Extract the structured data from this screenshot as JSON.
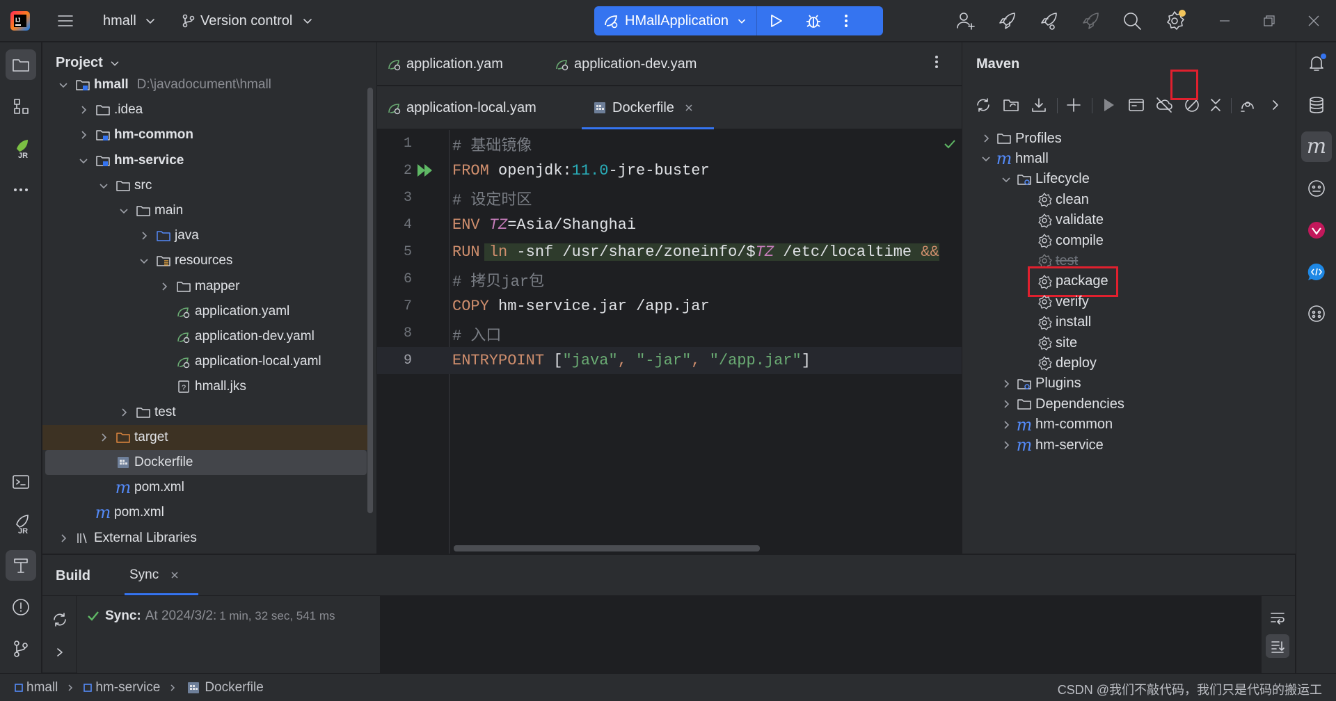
{
  "titlebar": {
    "project_name": "hmall",
    "vcs_label": "Version control",
    "run_config": "HMallApplication"
  },
  "project_panel": {
    "title": "Project",
    "tree": [
      {
        "label": "hmall",
        "path": "D:\\javadocument\\hmall",
        "bold": true,
        "icon": "module-folder-icon",
        "depth": 0,
        "chevron": "down"
      },
      {
        "label": ".idea",
        "icon": "folder-icon",
        "depth": 1,
        "chevron": "right"
      },
      {
        "label": "hm-common",
        "bold": true,
        "icon": "module-folder-icon",
        "depth": 1,
        "chevron": "right"
      },
      {
        "label": "hm-service",
        "bold": true,
        "icon": "module-folder-icon",
        "depth": 1,
        "chevron": "down"
      },
      {
        "label": "src",
        "icon": "folder-icon",
        "depth": 2,
        "chevron": "down"
      },
      {
        "label": "main",
        "icon": "folder-icon",
        "depth": 3,
        "chevron": "down"
      },
      {
        "label": "java",
        "icon": "source-folder-icon",
        "depth": 4,
        "chevron": "right"
      },
      {
        "label": "resources",
        "icon": "resources-folder-icon",
        "depth": 4,
        "chevron": "down"
      },
      {
        "label": "mapper",
        "icon": "folder-icon",
        "depth": 5,
        "chevron": "right"
      },
      {
        "label": "application.yaml",
        "icon": "spring-yaml-icon",
        "depth": 5
      },
      {
        "label": "application-dev.yaml",
        "icon": "spring-yaml-icon",
        "depth": 5
      },
      {
        "label": "application-local.yaml",
        "icon": "spring-yaml-icon",
        "depth": 5
      },
      {
        "label": "hmall.jks",
        "icon": "unknown-file-icon",
        "depth": 5
      },
      {
        "label": "test",
        "icon": "folder-icon",
        "depth": 3,
        "chevron": "right"
      },
      {
        "label": "target",
        "icon": "excluded-folder-icon",
        "depth": 2,
        "chevron": "right",
        "highlight": "target"
      },
      {
        "label": "Dockerfile",
        "icon": "docker-icon",
        "depth": 2,
        "highlight": "selected"
      },
      {
        "label": "pom.xml",
        "icon": "maven-icon",
        "depth": 2
      },
      {
        "label": "pom.xml",
        "icon": "maven-icon",
        "depth": 1
      },
      {
        "label": "External Libraries",
        "icon": "library-icon",
        "depth": 0,
        "chevron": "right"
      }
    ]
  },
  "editor": {
    "tabs_row1": [
      {
        "label": "application.yam"
      },
      {
        "label": "application-dev.yam"
      }
    ],
    "tabs_row2": [
      {
        "label": "application-local.yam"
      },
      {
        "label": "Dockerfile",
        "active": true
      }
    ],
    "lines": [
      {
        "n": "1",
        "tokens": [
          {
            "t": "# 基础镜像",
            "c": "cmt"
          }
        ]
      },
      {
        "n": "2",
        "tokens": [
          {
            "t": "FROM",
            "c": "kw"
          },
          {
            "t": " openjdk:",
            "c": ""
          },
          {
            "t": "11.0",
            "c": "num"
          },
          {
            "t": "-jre-buster",
            "c": ""
          }
        ]
      },
      {
        "n": "3",
        "tokens": [
          {
            "t": "# 设定时区",
            "c": "cmt"
          }
        ]
      },
      {
        "n": "4",
        "tokens": [
          {
            "t": "ENV",
            "c": "kw"
          },
          {
            "t": " ",
            "c": ""
          },
          {
            "t": "TZ",
            "c": "var"
          },
          {
            "t": "=Asia/Shanghai",
            "c": ""
          }
        ]
      },
      {
        "n": "5",
        "tokens": [
          {
            "t": "RUN",
            "c": "kw"
          },
          {
            "t": " ",
            "c": ""
          },
          {
            "t": "ln",
            "c": "kw"
          },
          {
            "t": " -snf /usr/share/zoneinfo/$",
            "c": ""
          },
          {
            "t": "TZ",
            "c": "var"
          },
          {
            "t": " /etc/localtime ",
            "c": ""
          },
          {
            "t": "&&",
            "c": "kw"
          }
        ]
      },
      {
        "n": "6",
        "tokens": [
          {
            "t": "# 拷贝jar包",
            "c": "cmt"
          }
        ]
      },
      {
        "n": "7",
        "tokens": [
          {
            "t": "COPY",
            "c": "kw"
          },
          {
            "t": " hm-service.jar /app.jar",
            "c": ""
          }
        ]
      },
      {
        "n": "8",
        "tokens": [
          {
            "t": "# 入口",
            "c": "cmt"
          }
        ]
      },
      {
        "n": "9",
        "tokens": [
          {
            "t": "ENTRYPOINT",
            "c": "kw"
          },
          {
            "t": " [",
            "c": ""
          },
          {
            "t": "\"java\"",
            "c": "str"
          },
          {
            "t": ", ",
            "c": "kw"
          },
          {
            "t": "\"-jar\"",
            "c": "str"
          },
          {
            "t": ", ",
            "c": "kw"
          },
          {
            "t": "\"/app.jar\"",
            "c": "str"
          },
          {
            "t": "]",
            "c": ""
          }
        ]
      }
    ]
  },
  "maven": {
    "title": "Maven",
    "tree": [
      {
        "label": "Profiles",
        "icon": "folder-icon",
        "depth": 0,
        "chevron": "right"
      },
      {
        "label": "hmall",
        "icon": "maven-icon",
        "depth": 0,
        "chevron": "down"
      },
      {
        "label": "Lifecycle",
        "icon": "lifecycle-folder-icon",
        "depth": 1,
        "chevron": "down"
      },
      {
        "label": "clean",
        "icon": "gear-icon",
        "depth": 2
      },
      {
        "label": "validate",
        "icon": "gear-icon",
        "depth": 2
      },
      {
        "label": "compile",
        "icon": "gear-icon",
        "depth": 2
      },
      {
        "label": "test",
        "icon": "gear-icon",
        "depth": 2,
        "disabled": true
      },
      {
        "label": "package",
        "icon": "gear-icon",
        "depth": 2,
        "boxed": true
      },
      {
        "label": "verify",
        "icon": "gear-icon",
        "depth": 2
      },
      {
        "label": "install",
        "icon": "gear-icon",
        "depth": 2
      },
      {
        "label": "site",
        "icon": "gear-icon",
        "depth": 2
      },
      {
        "label": "deploy",
        "icon": "gear-icon",
        "depth": 2
      },
      {
        "label": "Plugins",
        "icon": "lifecycle-folder-icon",
        "depth": 1,
        "chevron": "right"
      },
      {
        "label": "Dependencies",
        "icon": "folder-icon",
        "depth": 1,
        "chevron": "right"
      },
      {
        "label": "hm-common",
        "icon": "maven-icon",
        "depth": 1,
        "chevron": "right"
      },
      {
        "label": "hm-service",
        "icon": "maven-icon",
        "depth": 1,
        "chevron": "right"
      }
    ]
  },
  "build": {
    "tab_build": "Build",
    "tab_sync": "Sync",
    "sync_label": "Sync:",
    "sync_text": "At 2024/3/2:",
    "sync_time": "1 min, 32 sec, 541 ms"
  },
  "status_bar": {
    "crumbs": [
      "hmall",
      "hm-service",
      "Dockerfile"
    ],
    "watermark": "CSDN @我们不敲代码，我们只是代码的搬运工"
  }
}
